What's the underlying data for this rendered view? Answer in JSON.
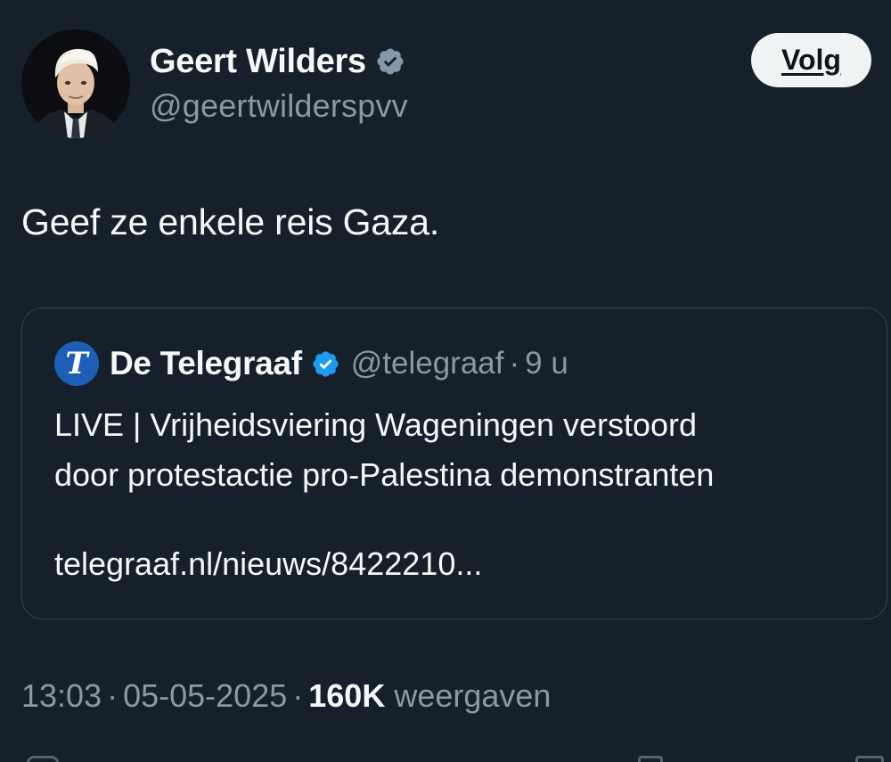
{
  "author": {
    "display_name": "Geert Wilders",
    "handle": "@geertwilderspvv",
    "verified": true
  },
  "follow_button": {
    "label": "Volg"
  },
  "tweet": {
    "text": "Geef ze enkele reis Gaza."
  },
  "quoted_tweet": {
    "logo_glyph": "T",
    "display_name": "De Telegraaf",
    "handle": "@telegraaf",
    "separator": "·",
    "time": "9 u",
    "text_line1": "LIVE | Vrijheidsviering Wageningen verstoord",
    "text_line2": "door protestactie pro-Palestina demonstranten",
    "link": "telegraaf.nl/nieuws/8422210..."
  },
  "meta": {
    "time": "13:03",
    "separator": "·",
    "date": "05-05-2025",
    "views_count": "160K",
    "views_label": "weergaven"
  },
  "colors": {
    "background": "#15202b",
    "text_primary": "#f7f9f9",
    "text_secondary": "#8b98a5",
    "border": "#38444d",
    "verified_blue": "#1d9bf0",
    "verified_grey": "#829aab",
    "logo_blue": "#1d5fb5"
  },
  "icons": {
    "author_badge": "verified-grey-icon",
    "quote_badge": "verified-blue-icon"
  }
}
